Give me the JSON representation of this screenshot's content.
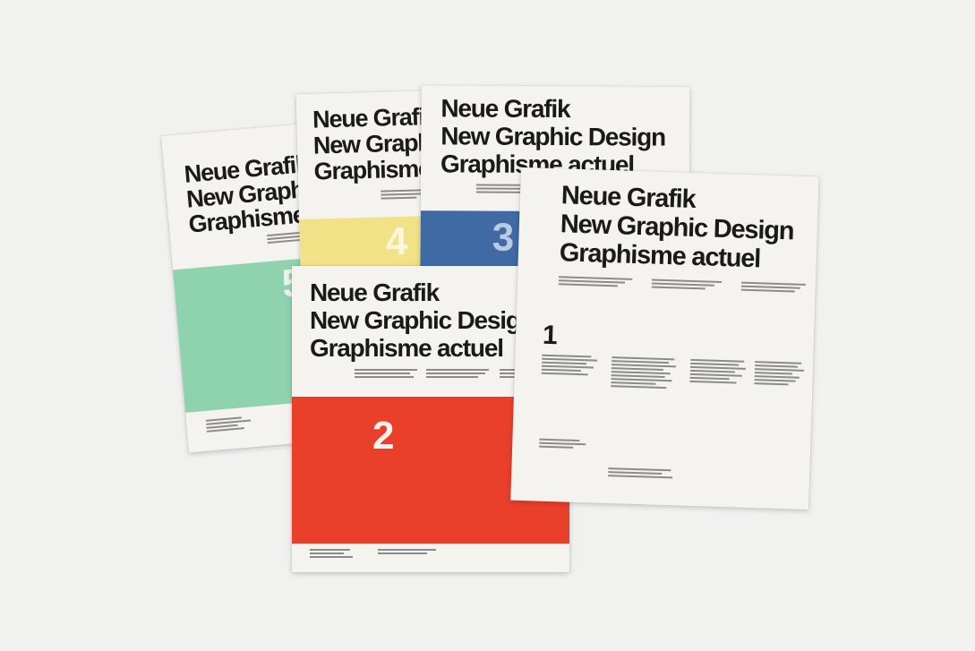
{
  "covers": [
    {
      "id": "issue-5",
      "number": "5",
      "title_lines": [
        "Neue Grafik",
        "New Graphic Design",
        "Graphisme actuel"
      ],
      "band_color": "#8fd3ae"
    },
    {
      "id": "issue-4",
      "number": "4",
      "title_lines": [
        "Neue Grafik",
        "New Graphic Design",
        "Graphisme actuel"
      ],
      "band_color": "#f1e288"
    },
    {
      "id": "issue-3",
      "number": "3",
      "title_lines": [
        "Neue Grafik",
        "New Graphic Design",
        "Graphisme actuel"
      ],
      "band_color": "#3f6aa4"
    },
    {
      "id": "issue-2",
      "number": "2",
      "title_lines": [
        "Neue Grafik",
        "New Graphic Design",
        "Graphisme actuel"
      ],
      "band_color": "#ea3f2b"
    },
    {
      "id": "issue-1",
      "number": "1",
      "title_lines": [
        "Neue Grafik",
        "New Graphic Design",
        "Graphisme actuel"
      ],
      "band_color": ""
    }
  ]
}
